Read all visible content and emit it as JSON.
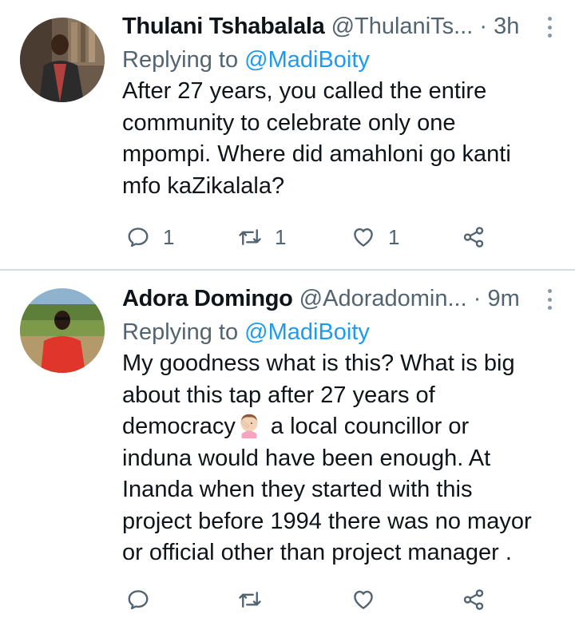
{
  "tweets": [
    {
      "display_name": "Thulani Tshabalala",
      "handle": "@ThulaniTs...",
      "dot": "·",
      "time": "3h",
      "replying_prefix": "Replying to ",
      "replying_to": "@MadiBoity",
      "text_lines": [
        "After 27 years, you called the entire",
        "community to celebrate only one",
        "mpompi. Where did amahloni go kanti",
        "mfo kaZikalala?"
      ],
      "reply_count": "1",
      "retweet_count": "1",
      "like_count": "1"
    },
    {
      "display_name": "Adora Domingo",
      "handle": "@Adoradomin...",
      "dot": "·",
      "time": "9m",
      "replying_prefix": "Replying to ",
      "replying_to": "@MadiBoity",
      "text_lines": [
        "My goodness what is this? What is big",
        "about this tap after 27 years of",
        "democracy",
        " a local councillor or",
        "induna would have been enough. At",
        "Inanda when they started with this",
        "project before 1994 there was no mayor",
        "or official other than project manager ."
      ],
      "reply_count": "",
      "retweet_count": "",
      "like_count": ""
    }
  ],
  "colors": {
    "accent": "#1d9bf0",
    "secondary_text": "#536471",
    "divider": "#d6dce0"
  },
  "icons": [
    "reply-icon",
    "retweet-icon",
    "like-icon",
    "share-icon",
    "more-options-icon",
    "woman-facepalming-emoji"
  ]
}
